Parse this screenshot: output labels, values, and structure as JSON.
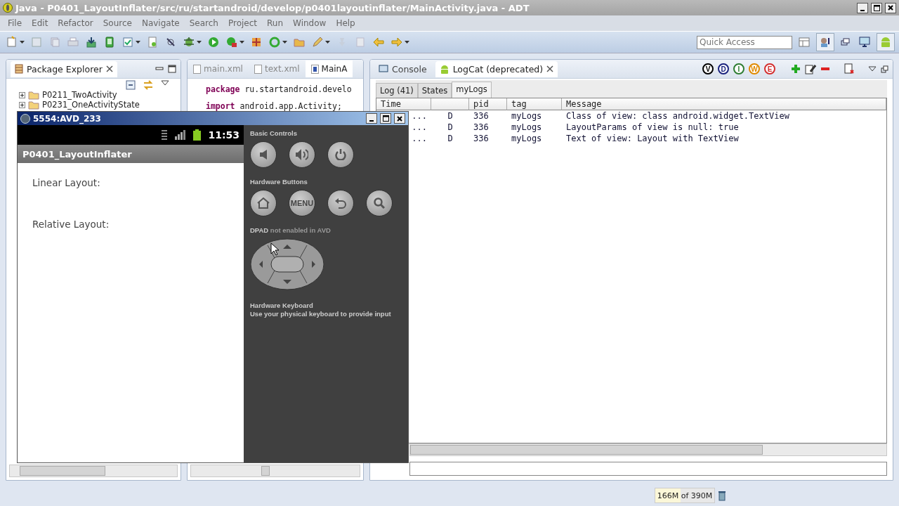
{
  "window": {
    "title": "Java - P0401_LayoutInflater/src/ru/startandroid/develop/p0401layoutinflater/MainActivity.java - ADT"
  },
  "menu": [
    "File",
    "Edit",
    "Refactor",
    "Source",
    "Navigate",
    "Search",
    "Project",
    "Run",
    "Window",
    "Help"
  ],
  "quick_access": {
    "placeholder": "Quick Access"
  },
  "package_explorer": {
    "title": "Package Explorer",
    "items": [
      {
        "label": "P0211_TwoActivity",
        "expanded": false
      },
      {
        "label": "P0231_OneActivityState",
        "expanded": false
      }
    ]
  },
  "editor": {
    "tabs": [
      {
        "label": "main.xml",
        "selected": false
      },
      {
        "label": "text.xml",
        "selected": false
      },
      {
        "label": "MainA",
        "selected": true
      }
    ],
    "lines": [
      "**package** ru.startandroid.develo",
      "**import** android.app.Activity;"
    ]
  },
  "logcat": {
    "views": [
      {
        "label": "Console",
        "selected": false
      },
      {
        "label": "LogCat (deprecated)",
        "selected": true
      }
    ],
    "levels": [
      {
        "label": "V",
        "color": "#000000"
      },
      {
        "label": "D",
        "color": "#1a237e"
      },
      {
        "label": "I",
        "color": "#2e7d32"
      },
      {
        "label": "W",
        "color": "#e08a00"
      },
      {
        "label": "E",
        "color": "#d32f2f"
      }
    ],
    "filters": [
      {
        "label": "Log (41)",
        "selected": false
      },
      {
        "label": "States",
        "selected": false
      },
      {
        "label": "myLogs",
        "selected": true
      }
    ],
    "columns": {
      "time": "Time",
      "pid": "pid",
      "tag": "tag",
      "message": "Message"
    },
    "rows": [
      {
        "time": "...",
        "level": "D",
        "pid": "336",
        "tag": "myLogs",
        "message": "Class of view: class android.widget.TextView"
      },
      {
        "time": "...",
        "level": "D",
        "pid": "336",
        "tag": "myLogs",
        "message": "LayoutParams of view is null: true"
      },
      {
        "time": "...",
        "level": "D",
        "pid": "336",
        "tag": "myLogs",
        "message": "Text of view: Layout with TextView"
      }
    ]
  },
  "emulator": {
    "title": "5554:AVD_233",
    "clock": "11:53",
    "app_title": "P0401_LayoutInflater",
    "labels": [
      "Linear Layout:",
      "Relative Layout:"
    ],
    "basic_title": "Basic Controls",
    "hardware_title": "Hardware Buttons",
    "menu_key": "MENU",
    "dpad_title": "DPAD",
    "dpad_note": "not enabled in AVD",
    "keyboard_title": "Hardware Keyboard",
    "keyboard_note": "Use your physical keyboard to provide input"
  },
  "status_bar": {
    "memory": "166M of 390M",
    "level": 0.43
  }
}
